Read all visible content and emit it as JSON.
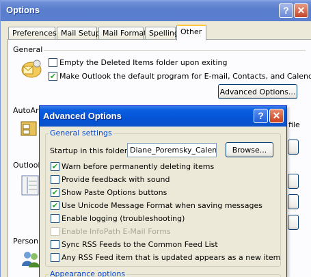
{
  "window": {
    "title": "Options"
  },
  "tabs": [
    "Preferences",
    "Mail Setup",
    "Mail Format",
    "Spelling",
    "Other"
  ],
  "general": {
    "heading": "General",
    "opt1": "Empty the Deleted Items folder upon exiting",
    "opt2": "Make Outlook the default program for E-mail, Contacts, and Calendar.",
    "advanced_button": "Advanced Options..."
  },
  "background_labels": {
    "autoarchive": "AutoArc",
    "outlook_panes": "Outlook",
    "person_names": "Person",
    "file_fragment": "file"
  },
  "dialog": {
    "title": "Advanced Options",
    "general_settings": "General settings",
    "startup_label": "Startup in this folder:",
    "startup_value": "Diane_Poremsky_Calendar",
    "browse_button": "Browse...",
    "options": [
      {
        "label": "Warn before permanently deleting items",
        "checked": true,
        "enabled": true
      },
      {
        "label": "Provide feedback with sound",
        "checked": false,
        "enabled": true
      },
      {
        "label": "Show Paste Options buttons",
        "checked": true,
        "enabled": true
      },
      {
        "label": "Use Unicode Message Format when saving messages",
        "checked": true,
        "enabled": true
      },
      {
        "label": "Enable logging (troubleshooting)",
        "checked": false,
        "enabled": true
      },
      {
        "label": "Enable InfoPath E-Mail Forms",
        "checked": false,
        "enabled": false
      },
      {
        "label": "Sync RSS Feeds to the Common Feed List",
        "checked": false,
        "enabled": true
      },
      {
        "label": "Any RSS Feed item that is updated appears as a new item",
        "checked": false,
        "enabled": true
      }
    ],
    "appearance_options": "Appearance options"
  },
  "glyphs": {
    "check": "✔",
    "help": "?",
    "close": "✕"
  },
  "colors": {
    "legend_blue": "#0046d5",
    "xp_title_blue": "#0554d6",
    "check_green": "#21a121"
  }
}
